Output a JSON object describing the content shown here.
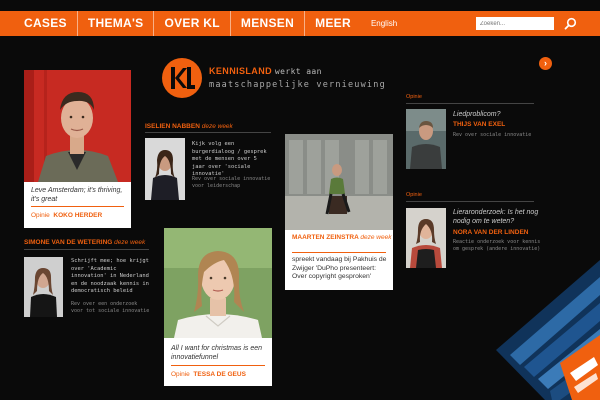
{
  "nav": {
    "items": [
      "CASES",
      "THEMA'S",
      "OVER KL",
      "MENSEN",
      "MEER"
    ],
    "lang": "English",
    "search_placeholder": "Zoeken..."
  },
  "logo": {
    "name": "KENNISLAND",
    "name_suffix": "werkt aan",
    "tagline": "maatschappelijke vernieuwing"
  },
  "cards": {
    "koko": {
      "quote": "Leve Amsterdam; it's thriving, it's great",
      "label": "Opinie",
      "name": "KOKO HERDER"
    },
    "tessa": {
      "quote": "All I want for christmas is een innovatiefunnel",
      "label": "Opinie",
      "name": "TESSA DE GEUS"
    },
    "maarten": {
      "name": "MAARTEN ZEINSTRA",
      "week": "deze week",
      "text": "spreekt vandaag bij Pakhuis de Zwijger 'DuPho presenteert: Over copyright gesproken'"
    }
  },
  "iselien": {
    "name": "ISELIEN NABBEN",
    "week": "deze week",
    "text": "Kijk volg een burgerdialoog / gesprek met de mensen over 5 jaar over 'sociale innovatie'",
    "meta": "Rev over sociale innovatie voor leiderschap"
  },
  "simone": {
    "name": "SIMONE VAN DE WETERING",
    "week": "deze week",
    "text": "Schrijft mee; hoe krijgt over 'Academic innovation' in Nederland en de noodzaak kennis in democratisch beleid",
    "meta": "Rev over een onderzoek voor tot sociale innovatie"
  },
  "right": {
    "thijs": {
      "label": "Opinie",
      "title": "Liedproblicom?",
      "name": "THIJS VAN EXEL",
      "meta": "Rev over sociale innovatie"
    },
    "nora": {
      "label": "Opinie",
      "title": "Lieraronderzoek: Is het nog nodig om te weten?",
      "name": "NORA VAN DER LINDEN",
      "meta": "Reactie onderzoek voor kennis om gesprek (andere innovatie)"
    }
  },
  "colors": {
    "accent": "#f0600f",
    "background": "#0a0a0a"
  }
}
